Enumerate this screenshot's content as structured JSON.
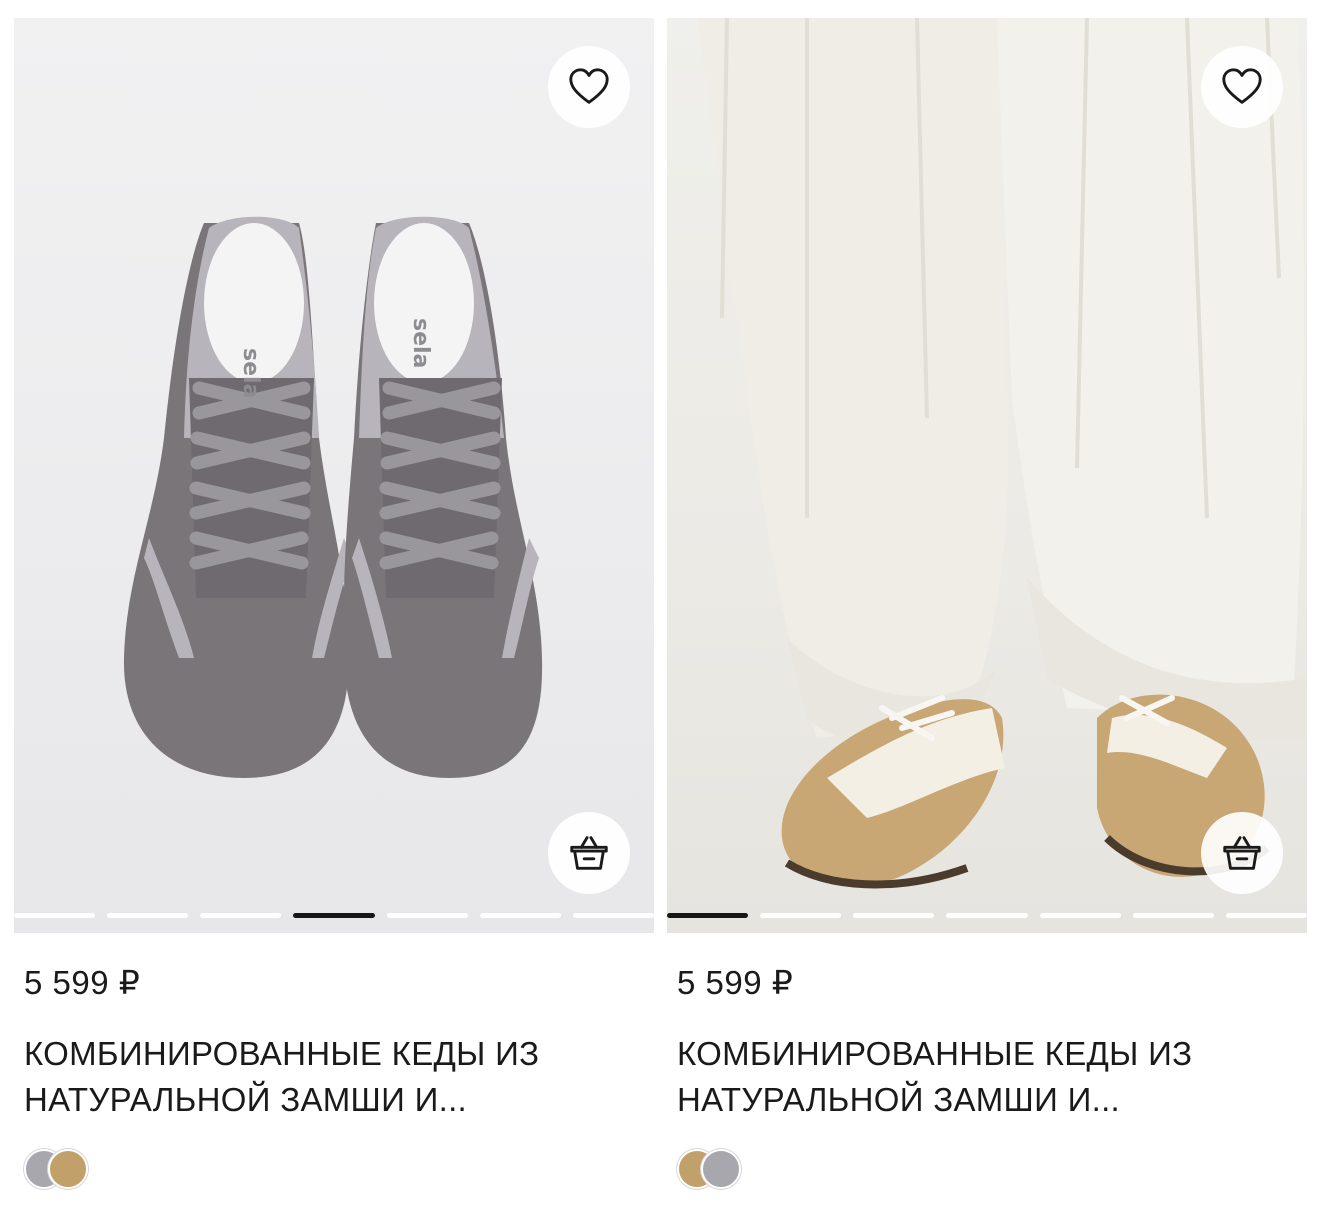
{
  "products": [
    {
      "price": "5 599 ₽",
      "title_line1": "КОМБИНИРОВАННЫЕ КЕДЫ ИЗ",
      "title_line2": "НАТУРАЛЬНОЙ ЗАМШИ И...",
      "active_slide": 4,
      "slide_count": 7,
      "swatches": [
        {
          "name": "grey",
          "color": "#a8a7ae"
        },
        {
          "name": "beige",
          "color": "#c2a06a"
        }
      ],
      "insole_brand": "selа"
    },
    {
      "price": "5 599 ₽",
      "title_line1": "КОМБИНИРОВАННЫЕ КЕДЫ ИЗ",
      "title_line2": "НАТУРАЛЬНОЙ ЗАМШИ И...",
      "active_slide": 1,
      "slide_count": 7,
      "swatches": [
        {
          "name": "beige",
          "color": "#c2a06a"
        },
        {
          "name": "grey",
          "color": "#a8a7ae"
        }
      ]
    }
  ],
  "icons": {
    "favorite": "heart-icon",
    "cart": "basket-icon"
  },
  "colors": {
    "active_dot": "#161616",
    "text": "#1a1a1a"
  }
}
